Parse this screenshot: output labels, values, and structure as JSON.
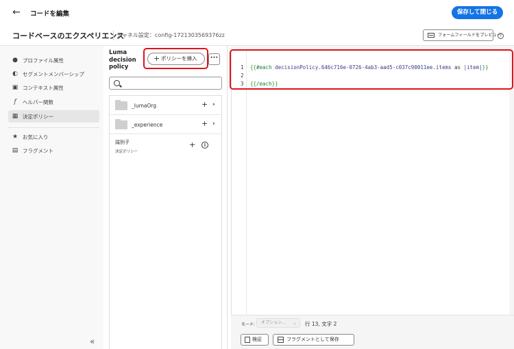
{
  "header": {
    "back_icon": "arrow-left-icon",
    "title": "コードを編集",
    "save_close_label": "保存して閉じる"
  },
  "subheader": {
    "experience_title": "コードベースのエクスペリエンス",
    "channel_label": "チャネル設定：config-1721303569376zz",
    "preview_label": "フォームフィールドをプレビュー",
    "help_icon": "help-icon"
  },
  "sidebar": {
    "items": [
      {
        "label": "プロファイル属性",
        "icon": "person-icon"
      },
      {
        "label": "セグメントメンバーシップ",
        "icon": "segment-icon"
      },
      {
        "label": "コンテキスト属性",
        "icon": "context-icon"
      },
      {
        "label": "ヘルパー関数",
        "icon": "function-icon"
      },
      {
        "label": "決定ポリシー",
        "icon": "decision-policy-icon"
      },
      {
        "label": "お気に入り",
        "icon": "star-icon"
      },
      {
        "label": "フラグメント",
        "icon": "fragment-icon"
      }
    ],
    "active_index": 4,
    "collapse_icon": "collapse-left-icon"
  },
  "policy_panel": {
    "title": "Luma decision policy",
    "insert_label": "ポリシーを挿入",
    "more_label": "···",
    "search_placeholder": "",
    "rows": [
      {
        "label": "_lumaOrg"
      },
      {
        "label": "_experience"
      }
    ],
    "identifier": {
      "label": "識別子",
      "sub": "決定ポリシー"
    }
  },
  "editor": {
    "line_numbers": [
      "1",
      "2",
      "3"
    ],
    "line1": {
      "open_brace": "{{",
      "key": "#each",
      "path": "decisionPolicy.646c716e-0726-4ab3-aad5-c037c90011ee.items",
      "kw": "as",
      "var": "|item|",
      "close_brace": "}}"
    },
    "line3": {
      "open_brace": "{{",
      "key": "/each",
      "close_brace": "}}"
    }
  },
  "status": {
    "mode_label": "モード:",
    "mode_value": "オプション...",
    "position": "行 13, 文字 2"
  },
  "footer": {
    "validate_label": "検証",
    "save_fragment_label": "フラグメントとして保存"
  },
  "colors": {
    "accent": "#1473e6",
    "highlight": "#e0111b"
  }
}
